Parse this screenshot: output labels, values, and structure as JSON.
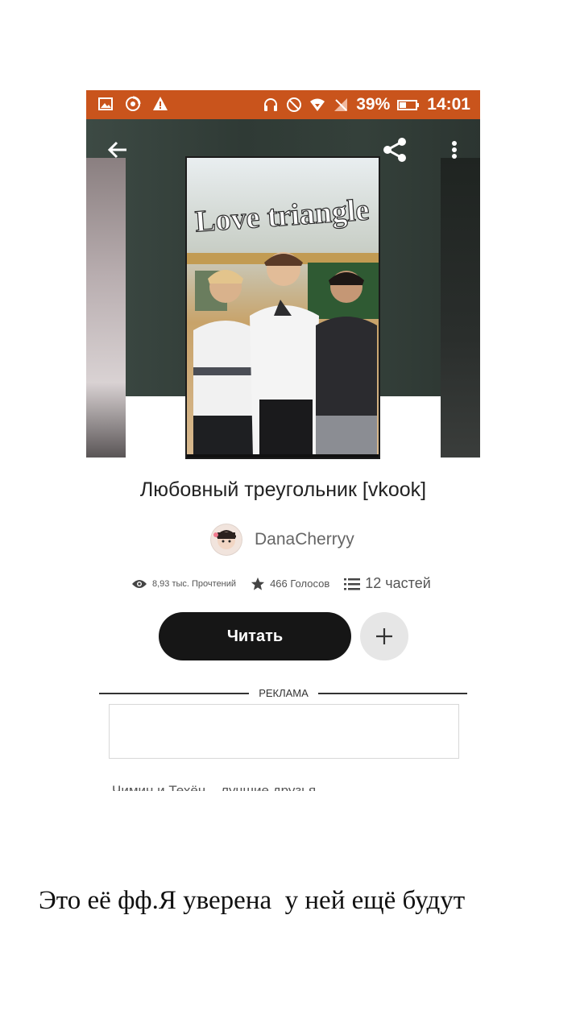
{
  "status_bar": {
    "battery_percent": "39%",
    "time": "14:01",
    "background_color": "#c9541c",
    "left_icons": [
      "image-icon",
      "sync-icon",
      "warning-icon"
    ],
    "right_icons": [
      "headset-icon",
      "do-not-disturb-icon",
      "wifi-icon",
      "no-signal-icon",
      "battery-icon"
    ]
  },
  "app_bar": {
    "back_icon": "arrow-left-icon",
    "share_icon": "share-icon",
    "menu_icon": "more-vertical-icon"
  },
  "cover": {
    "title_art": "Love triangle"
  },
  "story": {
    "title": "Любовный треугольник [vkook]",
    "author": "DanaCherryy",
    "reads": "8,93 тыс. Прочтений",
    "votes": "466 Голосов",
    "parts": "12 частей",
    "description_fragment": "Чимин и Техён – лучшие друзья"
  },
  "actions": {
    "read_label": "Читать",
    "add_icon": "plus-icon"
  },
  "ad": {
    "label": "РЕКЛАМА"
  },
  "caption": "Это её фф.Я уверена  у ней ещё будут"
}
